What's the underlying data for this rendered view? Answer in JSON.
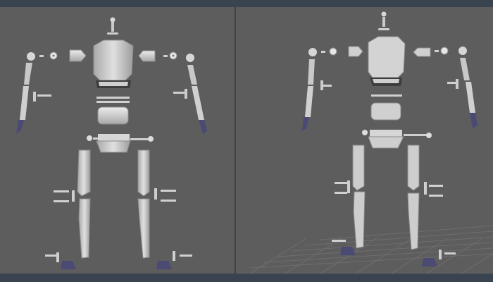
{
  "app": {
    "viewport_left": "front-view-viewport",
    "viewport_right": "perspective-viewport"
  },
  "colors": {
    "viewport_bg": "#5d5d5d",
    "ui_chrome": "#3a4350",
    "model_gray": "#c8c8c8",
    "model_dark": "#8f8f8f",
    "foot_blue": "#4b4a74",
    "grid": "#6d6d6d"
  },
  "icons": {
    "model": "robot-mesh-icon",
    "grid": "ground-grid-icon"
  }
}
